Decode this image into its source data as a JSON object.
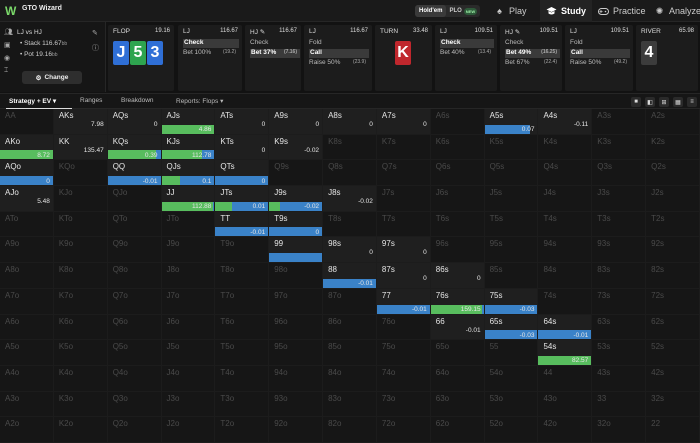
{
  "app": {
    "name": "GTO Wizard",
    "logo": "W"
  },
  "top": {
    "game_holdem": "Hold'em",
    "game_plo": "PLO",
    "new_badge": "NEW",
    "nav": [
      {
        "label": "Play",
        "icon": "spade-icon"
      },
      {
        "label": "Study",
        "icon": "study-cap-icon"
      },
      {
        "label": "Practice",
        "icon": "controller-icon"
      },
      {
        "label": "Analyze",
        "icon": "analyze-icon"
      }
    ]
  },
  "left": {
    "matchup": "LJ vs HJ",
    "stack_label": "Stack",
    "stack_value": "116.67",
    "pot_label": "Pot",
    "pot_value": "19.16",
    "bb": "bb",
    "change_label": "Change"
  },
  "strip": {
    "flop": {
      "title": "FLOP",
      "value": "19.16",
      "cards": [
        {
          "rank": "J",
          "color": "#2f6fd6"
        },
        {
          "rank": "5",
          "color": "#2ea44f"
        },
        {
          "rank": "3",
          "color": "#2f6fd6"
        }
      ]
    },
    "p1": {
      "title": "LJ",
      "value": "116.67",
      "opts": [
        {
          "label": "Check",
          "n": "",
          "sel": true
        },
        {
          "label": "Bet 100%",
          "n": "(19.2)",
          "sel": false
        }
      ]
    },
    "p2": {
      "title": "HJ ✎",
      "value": "116.67",
      "opts": [
        {
          "label": "Check",
          "n": "",
          "sel": false
        },
        {
          "label": "Bet 37%",
          "n": "(7.16)",
          "sel": true
        }
      ]
    },
    "p3": {
      "title": "LJ",
      "value": "116.67",
      "opts": [
        {
          "label": "Fold",
          "n": "",
          "sel": false
        },
        {
          "label": "Call",
          "n": "",
          "sel": true
        },
        {
          "label": "Raise 50%",
          "n": "(23.9)",
          "sel": false
        }
      ]
    },
    "turn": {
      "title": "TURN",
      "value": "33.48",
      "card": {
        "rank": "K",
        "color": "#c0272d"
      }
    },
    "p4": {
      "title": "LJ",
      "value": "109.51",
      "opts": [
        {
          "label": "Check",
          "n": "",
          "sel": true
        },
        {
          "label": "Bet 40%",
          "n": "(13.4)",
          "sel": false
        }
      ]
    },
    "p5": {
      "title": "HJ ✎",
      "value": "109.51",
      "opts": [
        {
          "label": "Check",
          "n": "",
          "sel": false
        },
        {
          "label": "Bet 49%",
          "n": "(16.25)",
          "sel": true
        },
        {
          "label": "Bet 67%",
          "n": "(22.4)",
          "sel": false
        }
      ]
    },
    "p6": {
      "title": "LJ",
      "value": "109.51",
      "opts": [
        {
          "label": "Fold",
          "n": "",
          "sel": false
        },
        {
          "label": "Call",
          "n": "",
          "sel": true
        },
        {
          "label": "Raise 50%",
          "n": "(49.2)",
          "sel": false
        }
      ]
    },
    "river": {
      "title": "RIVER",
      "value": "65.98",
      "card": {
        "rank": "4",
        "color": "#3c3c3c"
      }
    }
  },
  "tabs": {
    "strategy": "Strategy + EV",
    "ranges": "Ranges",
    "breakdown": "Breakdown",
    "reports": "Reports: Flops"
  },
  "colors": {
    "green": "#58bd5e",
    "blue": "#3a82c8"
  },
  "grid": {
    "ranks": [
      "A",
      "K",
      "Q",
      "J",
      "T",
      "9",
      "8",
      "7",
      "6",
      "5",
      "4",
      "3",
      "2"
    ],
    "active": {
      "AKs": {
        "ev": "7.98"
      },
      "AQs": {
        "ev": "0"
      },
      "AJs": {
        "ev": "4.86",
        "bars": [
          {
            "c": "g",
            "w": 1
          }
        ]
      },
      "ATs": {
        "ev": "0"
      },
      "A9s": {
        "ev": "0"
      },
      "A8s": {
        "ev": "0"
      },
      "A7s": {
        "ev": "0"
      },
      "A5s": {
        "ev": "0.07",
        "bars": [
          {
            "c": "b",
            "w": 0.85
          }
        ]
      },
      "A4s": {
        "ev": "-0.11"
      },
      "AKo": {
        "ev": "8.72",
        "bars": [
          {
            "c": "g",
            "w": 1
          }
        ]
      },
      "KK": {
        "ev": "135.47"
      },
      "KQs": {
        "ev": "0.39",
        "bars": [
          {
            "c": "g",
            "w": 0.9
          },
          {
            "c": "b",
            "w": 0.1
          }
        ]
      },
      "KJs": {
        "ev": "112.78",
        "bars": [
          {
            "c": "g",
            "w": 0.75
          },
          {
            "c": "b",
            "w": 0.25
          }
        ]
      },
      "KTs": {
        "ev": "0"
      },
      "K9s": {
        "ev": "-0.02"
      },
      "AQo": {
        "ev": "0",
        "bars": [
          {
            "c": "b",
            "w": 1
          }
        ]
      },
      "QQ": {
        "ev": "-0.01",
        "bars": [
          {
            "c": "b",
            "w": 1
          }
        ]
      },
      "QJs": {
        "ev": "0.1",
        "bars": [
          {
            "c": "g",
            "w": 0.35
          },
          {
            "c": "b",
            "w": 0.65
          }
        ]
      },
      "QTs": {
        "ev": "0",
        "bars": [
          {
            "c": "b",
            "w": 1
          }
        ]
      },
      "AJo": {
        "ev": "5.48"
      },
      "JJ": {
        "ev": "112.88",
        "bars": [
          {
            "c": "g",
            "w": 0.95
          },
          {
            "c": "b",
            "w": 0.05
          }
        ]
      },
      "JTs": {
        "ev": "0.01",
        "bars": [
          {
            "c": "g",
            "w": 0.3
          },
          {
            "c": "b",
            "w": 0.7
          }
        ]
      },
      "J9s": {
        "ev": "-0.02",
        "bars": [
          {
            "c": "g",
            "w": 0.2
          },
          {
            "c": "b",
            "w": 0.8
          }
        ]
      },
      "J8s": {
        "ev": "-0.02"
      },
      "TT": {
        "ev": "-0.01",
        "bars": [
          {
            "c": "b",
            "w": 1
          }
        ]
      },
      "T9s": {
        "ev": "0",
        "bars": [
          {
            "c": "b",
            "w": 1
          }
        ]
      },
      "99": {
        "ev": "",
        "bars": [
          {
            "c": "b",
            "w": 1
          }
        ]
      },
      "98s": {
        "ev": "0"
      },
      "97s": {
        "ev": "0"
      },
      "88": {
        "ev": "-0.01",
        "bars": [
          {
            "c": "b",
            "w": 1
          }
        ]
      },
      "87s": {
        "ev": "0"
      },
      "86s": {
        "ev": "0"
      },
      "77": {
        "ev": "-0.01",
        "bars": [
          {
            "c": "b",
            "w": 1
          }
        ]
      },
      "76s": {
        "ev": "159.15",
        "bars": [
          {
            "c": "g",
            "w": 0.95
          },
          {
            "c": "b",
            "w": 0.05
          }
        ]
      },
      "75s": {
        "ev": "-0.03",
        "bars": [
          {
            "c": "b",
            "w": 1
          }
        ]
      },
      "66": {
        "ev": "-0.01"
      },
      "65s": {
        "ev": "-0.03",
        "bars": [
          {
            "c": "b",
            "w": 1
          }
        ]
      },
      "64s": {
        "ev": "-0.01",
        "bars": [
          {
            "c": "b",
            "w": 1
          }
        ]
      },
      "54s": {
        "ev": "82.57",
        "bars": [
          {
            "c": "g",
            "w": 1
          }
        ]
      }
    }
  }
}
